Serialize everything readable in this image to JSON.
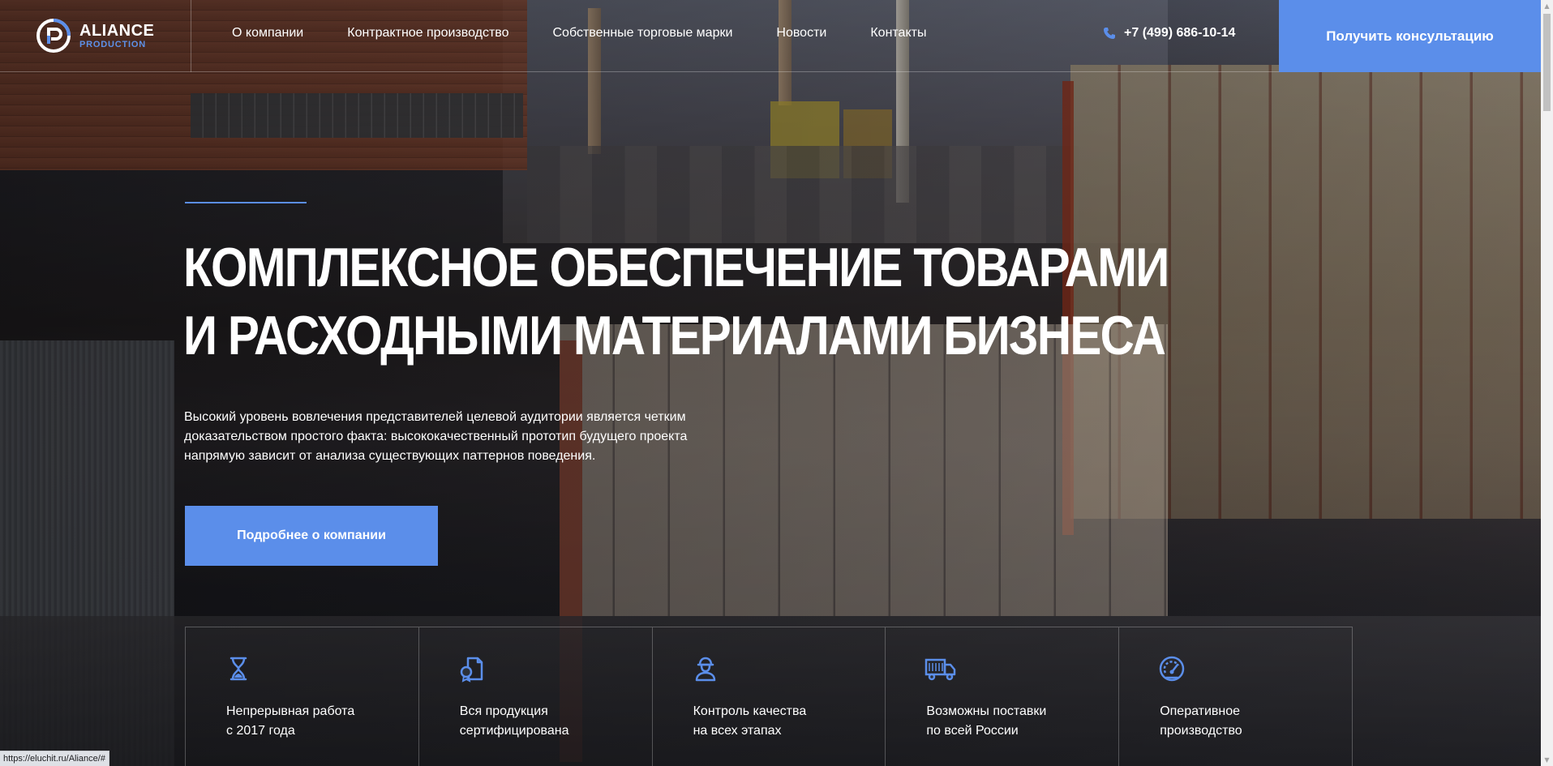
{
  "brand": {
    "name": "ALIANCE",
    "subtitle": "PRODUCTION"
  },
  "nav": {
    "items": [
      {
        "label": "О компании"
      },
      {
        "label": "Контрактное производство"
      },
      {
        "label": "Собственные торговые марки"
      },
      {
        "label": "Новости"
      },
      {
        "label": "Контакты"
      }
    ]
  },
  "header": {
    "phone": "+7 (499) 686-10-14",
    "consult_label": "Получить консультацию"
  },
  "hero": {
    "title_line1": "Комплексное обеспечение товарами",
    "title_line2": "и расходными материалами бизнеса",
    "desc_line1": "Высокий уровень вовлечения представителей целевой аудитории является четким",
    "desc_line2": "доказательством простого факта: высококачественный прототип будущего проекта",
    "desc_line3": "напрямую зависит от анализа существующих паттернов поведения.",
    "button_label": "Подробнее о компании"
  },
  "features": [
    {
      "icon": "hourglass-icon",
      "line1": "Непрерывная работа",
      "line2": "с 2017 года"
    },
    {
      "icon": "certificate-icon",
      "line1": "Вся продукция",
      "line2": "сертифицирована"
    },
    {
      "icon": "worker-icon",
      "line1": "Контроль качества",
      "line2": "на всех этапах"
    },
    {
      "icon": "truck-icon",
      "line1": "Возможны поставки",
      "line2": "по всей России"
    },
    {
      "icon": "speedometer-icon",
      "line1": "Оперативное",
      "line2": "производство"
    }
  ],
  "status_bar": {
    "url": "https://eluchit.ru/Aliance/#"
  },
  "colors": {
    "accent": "#5b8eea",
    "text": "#ffffff"
  }
}
